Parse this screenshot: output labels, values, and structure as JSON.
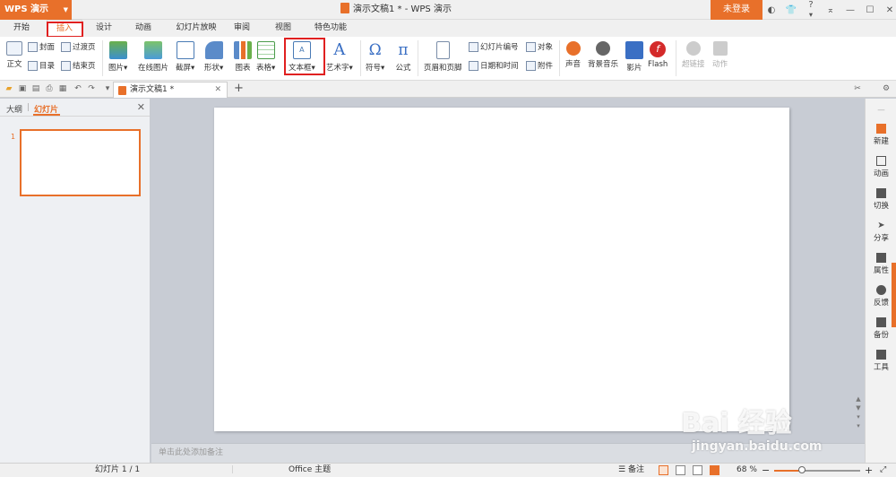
{
  "app": {
    "name": "WPS 演示",
    "window_title": "演示文稿1 * - WPS 演示",
    "login_label": "未登录",
    "title_icons": [
      "skin-icon",
      "shirt-icon",
      "help-icon",
      "collapse-icon",
      "minimize-icon",
      "maximize-icon",
      "close-icon"
    ],
    "help_label": "?"
  },
  "menu": {
    "tabs": [
      "开始",
      "插入",
      "设计",
      "动画",
      "幻灯片放映",
      "审阅",
      "视图",
      "特色功能"
    ],
    "active_tab": "插入"
  },
  "ribbon": {
    "zhengwen": "正文",
    "fengmian": "封面",
    "guodu": "过渡页",
    "mulu": "目录",
    "jieshu": "结束页",
    "picture": "图片",
    "online_picture": "在线图片",
    "screenshot": "截屏",
    "shape": "形状",
    "chart": "图表",
    "table": "表格",
    "textbox": "文本框",
    "wordart": "艺术字",
    "symbol": "符号",
    "formula": "公式",
    "header_footer": "页眉和页脚",
    "slide_number": "幻灯片编号",
    "object": "对象",
    "datetime": "日期和时间",
    "attachment": "附件",
    "sound": "声音",
    "bg_music": "背景音乐",
    "movie": "影片",
    "flash": "Flash",
    "hyperlink": "超链接",
    "action": "动作",
    "dropdown_glyph": "▾"
  },
  "quickbar": {
    "doc_tab": "演示文稿1 *",
    "close_glyph": "✕",
    "add_glyph": "+"
  },
  "left_panel": {
    "tab_outline": "大纲",
    "tab_slides": "幻灯片",
    "divider": "|",
    "close_glyph": "✕",
    "slide_number": "1"
  },
  "notes": {
    "placeholder": "单击此处添加备注"
  },
  "right_sidebar": {
    "items": [
      "新建",
      "动画",
      "切换",
      "分享",
      "属性",
      "反馈",
      "备份",
      "工具"
    ]
  },
  "status": {
    "slide_info": "幻灯片 1 / 1",
    "theme": "Office 主题",
    "notes_label": "备注",
    "zoom": "68 %",
    "zoom_fraction": 0.32,
    "minus": "−",
    "plus": "+"
  },
  "watermark": {
    "brand": "Bai 经验",
    "url": "jingyan.baidu.com"
  },
  "colors": {
    "accent": "#e8702a",
    "highlight_box": "#e02020"
  }
}
